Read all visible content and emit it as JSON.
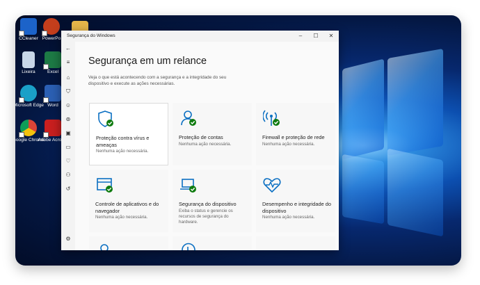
{
  "desktop": {
    "icons": [
      {
        "label": "CCleaner",
        "color": "#1c63c9"
      },
      {
        "label": "PowerPo",
        "color": "#c43e1c"
      },
      {
        "label": "",
        "color": "#e8b64a"
      },
      {
        "label": "Lixeira",
        "color": "#c8d6e8"
      },
      {
        "label": "Excel",
        "color": "#1d7a45"
      },
      {
        "label": "Microsoft Edge",
        "color": "#1aa0c8"
      },
      {
        "label": "Word",
        "color": "#2b5fb3"
      },
      {
        "label": "Google Chrome",
        "color": "#e3a21a"
      },
      {
        "label": "Adobe Acrobat",
        "color": "#c91f1f"
      }
    ]
  },
  "window": {
    "title": "Segurança do Windows",
    "controls": {
      "minimize": "–",
      "maximize": "☐",
      "close": "✕"
    }
  },
  "page": {
    "heading": "Segurança em um relance",
    "subtitle": "Veja o que está acontecendo com a segurança e a integridade do seu dispositivo e execute as ações necessárias."
  },
  "cards": [
    {
      "title": "Proteção contra vírus e ameaças",
      "desc": "Nenhuma ação necessária.",
      "icon": "shield-check-icon"
    },
    {
      "title": "Proteção de contas",
      "desc": "Nenhuma ação necessária.",
      "icon": "person-check-icon"
    },
    {
      "title": "Firewall e proteção de rede",
      "desc": "Nenhuma ação necessária.",
      "icon": "antenna-check-icon"
    },
    {
      "title": "Controle de aplicativos e do navegador",
      "desc": "Nenhuma ação necessária.",
      "icon": "app-window-check-icon"
    },
    {
      "title": "Segurança do dispositivo",
      "desc": "Exiba o status e gerencie os recursos de segurança do hardware.",
      "icon": "laptop-check-icon"
    },
    {
      "title": "Desempenho e integridade do dispositivo",
      "desc": "Nenhuma ação necessária.",
      "icon": "heart-pulse-icon"
    }
  ],
  "colors": {
    "accent": "#0a6fc2",
    "ok": "#0f7b0f"
  }
}
